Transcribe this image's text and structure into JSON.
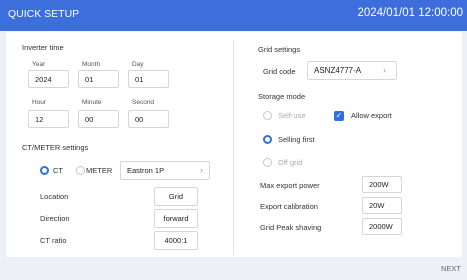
{
  "header": {
    "title": "QUICK SETUP",
    "datetime": "2024/01/01 12:00:00"
  },
  "inverter_time": {
    "section": "Inverter time",
    "year": {
      "label": "Year",
      "value": "2024"
    },
    "month": {
      "label": "Month",
      "value": "01"
    },
    "day": {
      "label": "Day",
      "value": "01"
    },
    "hour": {
      "label": "Hour",
      "value": "12"
    },
    "minute": {
      "label": "Minute",
      "value": "00"
    },
    "second": {
      "label": "Second",
      "value": "00"
    }
  },
  "ct_meter": {
    "section": "CT/METER settings",
    "ct_label": "CT",
    "meter_label": "METER",
    "selected": "CT",
    "meter_model": "Eastron 1P",
    "location": {
      "label": "Location",
      "value": "Grid"
    },
    "direction": {
      "label": "Direction",
      "value": "forward"
    },
    "ct_ratio": {
      "label": "CT ratio",
      "value": "4000:1"
    }
  },
  "grid_settings": {
    "section": "Grid settings",
    "grid_code_label": "Grid code",
    "grid_code_value": "ASNZ4777-A"
  },
  "storage_mode": {
    "section": "Storage mode",
    "self_use": "Self-use",
    "allow_export": "Allow export",
    "allow_export_checked": true,
    "selling_first": "Selling first",
    "off_grid": "Off grid",
    "selected": "Selling first"
  },
  "power": {
    "max_export": {
      "label": "Max export power",
      "value": "200W"
    },
    "export_cal": {
      "label": "Export calibration",
      "value": "20W"
    },
    "peak_shaving": {
      "label": "Grid Peak shaving",
      "value": "2000W"
    }
  },
  "footer": {
    "next": "NEXT"
  },
  "colors": {
    "accent": "#3c6fdc",
    "background": "#eef0f6"
  }
}
